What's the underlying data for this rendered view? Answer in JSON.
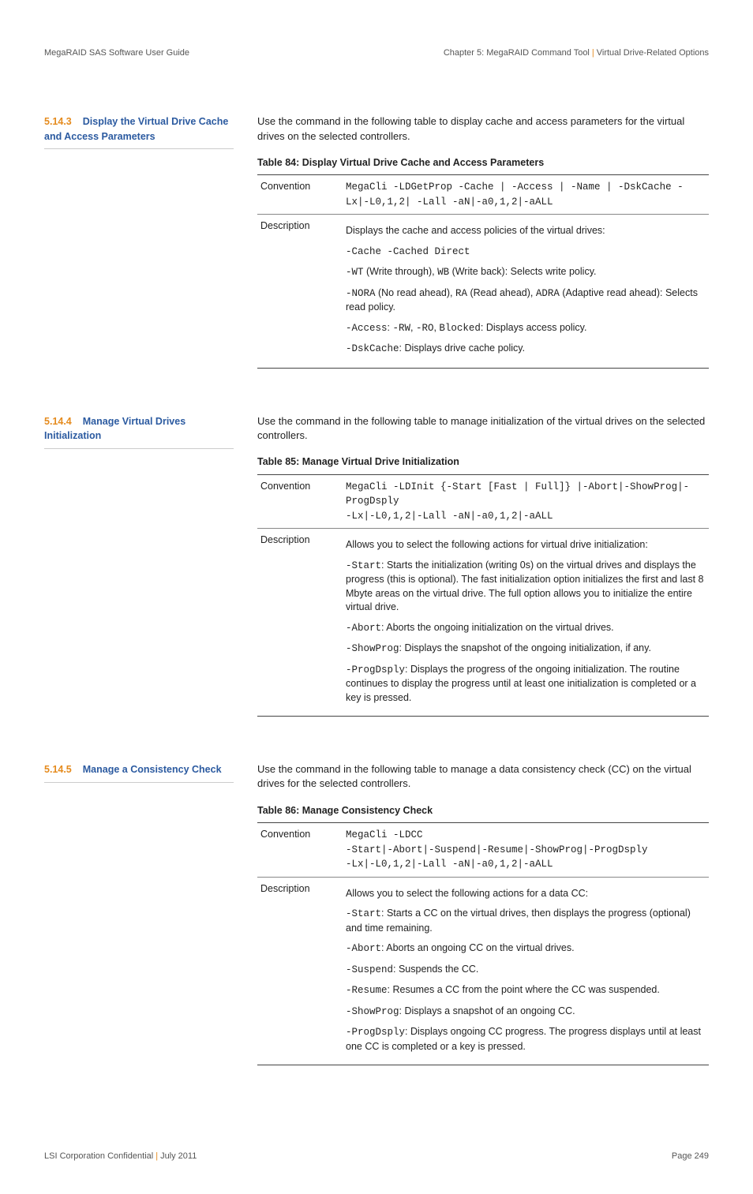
{
  "header": {
    "left": "MegaRAID SAS Software User Guide",
    "right_chapter": "Chapter 5:",
    "right_tool": "MegaRAID Command Tool",
    "right_topic": "Virtual Drive-Related Options"
  },
  "sections": [
    {
      "number": "5.14.3",
      "title_line1": "Display the Virtual Drive Cache",
      "title_line2": "and Access Parameters",
      "intro": "Use the command in the following table to display cache and access parameters for the virtual drives on the selected controllers.",
      "table_caption": "Table 84:   Display Virtual Drive Cache and Access Parameters",
      "convention_label": "Convention",
      "convention_value": "MegaCli -LDGetProp  -Cache | -Access | -Name | -DskCache -Lx|-L0,1,2| -Lall -aN|-a0,1,2|-aALL",
      "description_label": "Description",
      "description_intro": "Displays the cache and access policies of the virtual drives:",
      "description_items": [
        "<span class='mono'>-Cache -Cached Direct</span>",
        "<span class='mono'>-WT</span> (Write through), <span class='mono'>WB</span> (Write back): Selects write policy.",
        "<span class='mono'>-NORA</span> (No read ahead), <span class='mono'>RA</span> (Read ahead), <span class='mono'>ADRA</span> (Adaptive read ahead): Selects read policy.",
        "<span class='mono'>-Access</span>: <span class='mono'>-RW</span>, <span class='mono'>-RO</span>, <span class='mono'>Blocked</span>: Displays access policy.",
        "<span class='mono'>-DskCache</span>: Displays drive cache policy."
      ]
    },
    {
      "number": "5.14.4",
      "title_line1": "Manage Virtual Drives",
      "title_line2": "Initialization",
      "intro": "Use the command in the following table to manage initialization of the virtual drives on the selected controllers.",
      "table_caption": "Table 85:   Manage Virtual Drive Initialization",
      "convention_label": "Convention",
      "convention_value": "MegaCli -LDInit {-Start [Fast | Full]} |-Abort|-ShowProg|-ProgDsply\n-Lx|-L0,1,2|-Lall -aN|-a0,1,2|-aALL",
      "description_label": "Description",
      "description_intro": "Allows you to select the following actions for virtual drive initialization:",
      "description_items": [
        "<span class='mono'>-Start</span>: Starts the initialization (writing 0s) on the virtual drives and displays the progress (this is optional). The fast initialization option initializes the first and last 8 Mbyte areas on the virtual drive. The full option allows you to initialize the entire virtual drive.",
        "<span class='mono'>-Abort</span>: Aborts the ongoing initialization on the virtual drives.",
        "<span class='mono'>-ShowProg</span>: Displays the snapshot of the ongoing initialization, if any.",
        "<span class='mono'>-ProgDsply</span>: Displays the progress of the ongoing initialization. The routine continues to display the progress until at least one initialization is completed or a key is pressed."
      ]
    },
    {
      "number": "5.14.5",
      "title_line1": "Manage a Consistency Check",
      "title_line2": "",
      "intro": "Use the command in the following table to manage a data consistency check (CC) on the virtual drives for the selected controllers.",
      "table_caption": "Table 86:   Manage Consistency Check",
      "convention_label": "Convention",
      "convention_value": "MegaCli -LDCC\n-Start|-Abort|-Suspend|-Resume|-ShowProg|-ProgDsply\n-Lx|-L0,1,2|-Lall -aN|-a0,1,2|-aALL",
      "description_label": "Description",
      "description_intro": "Allows you to select the following actions for a data CC:",
      "description_items": [
        "<span class='mono'>-Start</span>: Starts a CC on the virtual drives, then displays the progress (optional) and time remaining.",
        "<span class='mono'>-Abort</span>: Aborts an ongoing CC on the virtual drives.",
        "<span class='mono'>-Suspend</span>: Suspends the CC.",
        "<span class='mono'>-Resume</span>: Resumes a CC from the point where the CC was suspended.",
        "<span class='mono'>-ShowProg</span>: Displays a snapshot of an ongoing CC.",
        "<span class='mono'>-ProgDsply</span>: Displays ongoing CC progress. The progress displays until at least one CC is completed or a key is pressed."
      ]
    }
  ],
  "footer": {
    "left_company": "LSI Corporation Confidential",
    "left_date": "July 2011",
    "right": "Page 249"
  }
}
